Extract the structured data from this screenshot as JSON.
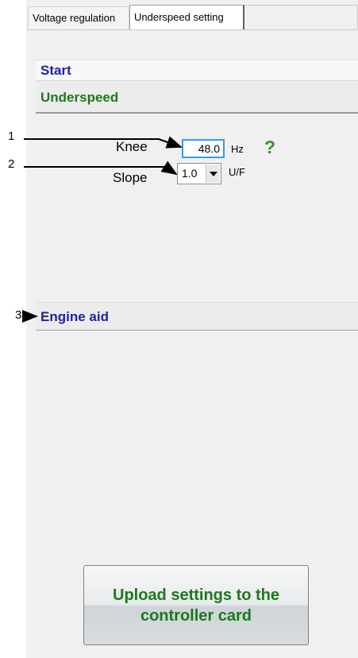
{
  "tabs": [
    {
      "label": "Voltage regulation",
      "active": false
    },
    {
      "label": "Underspeed setting",
      "active": true
    }
  ],
  "sections": {
    "start": "Start",
    "underspeed": "Underspeed",
    "engine_aid": "Engine aid"
  },
  "underspeed": {
    "knee_label": "Knee",
    "knee_value": "48.0",
    "knee_unit": "Hz",
    "slope_label": "Slope",
    "slope_value": "1.0",
    "slope_unit": "U/F",
    "help_symbol": "?"
  },
  "callouts": {
    "one": "1",
    "two": "2",
    "three": "3"
  },
  "upload_button": {
    "label": "Upload settings to the controller card"
  },
  "colors": {
    "section_blue": "#1f1fa8",
    "section_green": "#1a7a1a",
    "help_green": "#3a8f2f",
    "input_focus": "#3399ff"
  }
}
